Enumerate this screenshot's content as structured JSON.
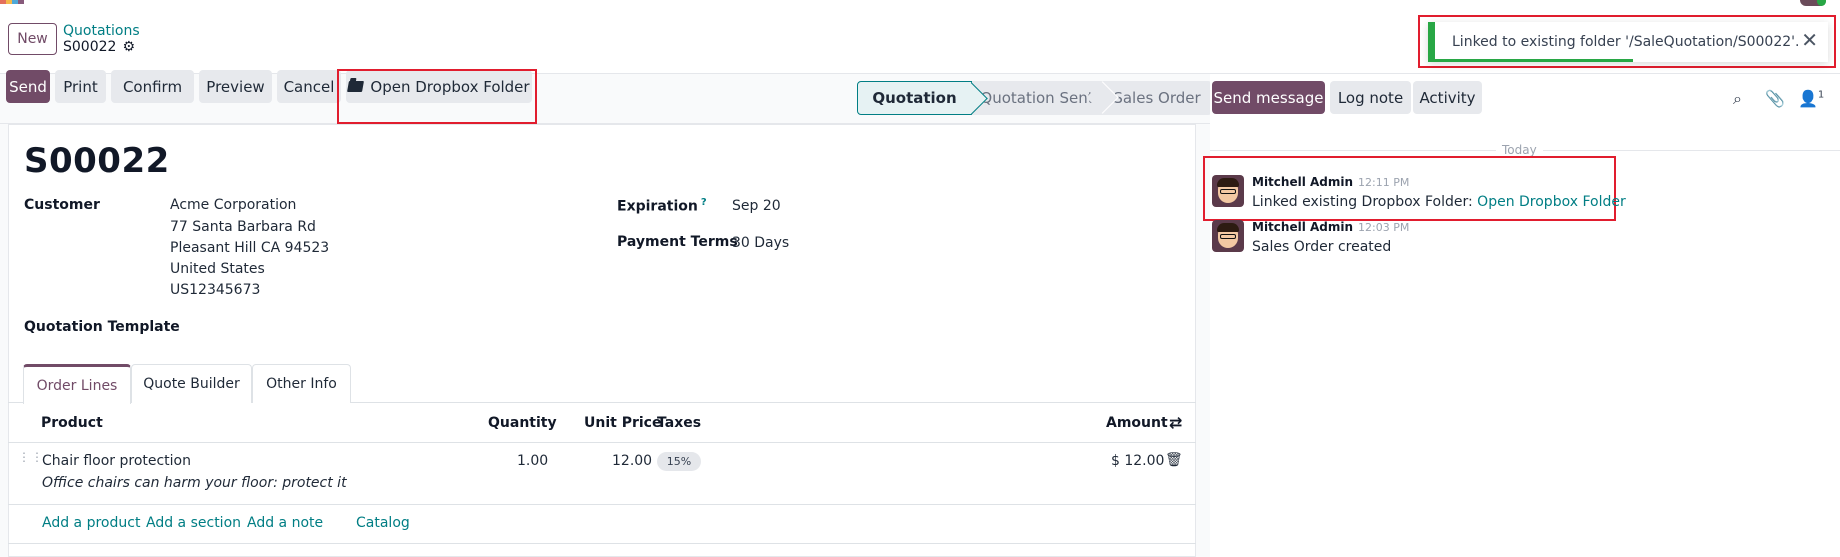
{
  "control_panel": {
    "new_label": "New",
    "breadcrumb": "Quotations",
    "record_name": "S00022"
  },
  "notification": {
    "message": "Linked to existing folder '/SaleQuotation/S00022'.",
    "close_glyph": "✕",
    "accent_color": "#28a745"
  },
  "action_bar": {
    "send": "Send",
    "print": "Print",
    "confirm": "Confirm",
    "preview": "Preview",
    "cancel": "Cancel",
    "open_dropbox": "Open Dropbox Folder"
  },
  "status_bar": {
    "stages": [
      "Quotation",
      "Quotation Sent",
      "Sales Order"
    ],
    "active": "Quotation"
  },
  "form": {
    "title": "S00022",
    "customer_label": "Customer",
    "customer_lines": [
      "Acme Corporation",
      "77 Santa Barbara Rd",
      "Pleasant Hill CA 94523",
      "United States",
      "US12345673"
    ],
    "expiration_label": "Expiration",
    "expiration_help": "?",
    "expiration_value": "Sep 20",
    "payment_terms_label": "Payment Terms",
    "payment_terms_value": "30 Days",
    "quotation_template_label": "Quotation Template"
  },
  "tabs": [
    "Order Lines",
    "Quote Builder",
    "Other Info"
  ],
  "order_lines": {
    "headers": {
      "product": "Product",
      "quantity": "Quantity",
      "unit_price": "Unit Price",
      "taxes": "Taxes",
      "amount": "Amount"
    },
    "rows": [
      {
        "product": "Chair floor protection",
        "description": "Office chairs can harm your floor: protect it",
        "quantity": "1.00",
        "unit_price": "12.00",
        "tax": "15%",
        "amount": "$ 12.00"
      }
    ],
    "add_links": [
      "Add a product",
      "Add a section",
      "Add a note",
      "Catalog"
    ]
  },
  "chatter": {
    "send_message": "Send message",
    "log_note": "Log note",
    "activity": "Activity",
    "follower_count": "1",
    "separator": "Today",
    "messages": [
      {
        "author": "Mitchell Admin",
        "time": "12:11 PM",
        "text": "Linked existing Dropbox Folder: ",
        "link": "Open Dropbox Folder"
      },
      {
        "author": "Mitchell Admin",
        "time": "12:03 PM",
        "text": "Sales Order created"
      }
    ]
  },
  "colors": {
    "brand": "#714b67",
    "link": "#017e84",
    "highlight": "#e11d2e"
  }
}
